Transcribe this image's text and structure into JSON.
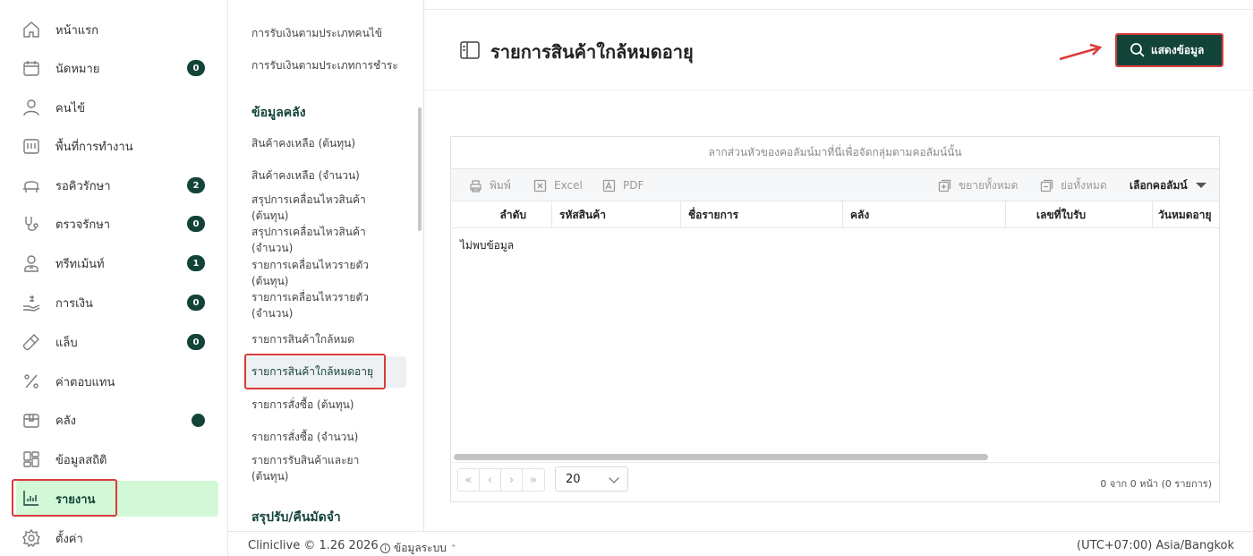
{
  "nav": {
    "items": [
      {
        "label": "หน้าแรก",
        "icon": "home-icon"
      },
      {
        "label": "นัดหมาย",
        "icon": "calendar-icon",
        "badge": "0"
      },
      {
        "label": "คนไข้",
        "icon": "person-icon"
      },
      {
        "label": "พื้นที่การทำงาน",
        "icon": "workspace-icon"
      },
      {
        "label": "รอคิวรักษา",
        "icon": "queue-icon",
        "badge": "2"
      },
      {
        "label": "ตรวจรักษา",
        "icon": "stethoscope-icon",
        "badge": "0"
      },
      {
        "label": "ทรีทเม้นท์",
        "icon": "treatment-icon",
        "badge": "1"
      },
      {
        "label": "การเงิน",
        "icon": "finance-icon",
        "badge": "0"
      },
      {
        "label": "แล็บ",
        "icon": "lab-tube-icon",
        "badge": "0"
      },
      {
        "label": "ค่าตอบแทน",
        "icon": "percent-icon"
      },
      {
        "label": "คลัง",
        "icon": "inventory-box-icon"
      },
      {
        "label": "ข้อมูลสถิติ",
        "icon": "statistics-icon"
      },
      {
        "label": "รายงาน",
        "icon": "report-chart-icon"
      },
      {
        "label": "ตั้งค่า",
        "icon": "gear-icon"
      }
    ]
  },
  "submenu": {
    "top_items": [
      "การรับเงินตามประเภทคนไข้",
      "การรับเงินตามประเภทการชำระ"
    ],
    "section_inventory": "ข้อมูลคลัง",
    "items": [
      "สินค้าคงเหลือ (ต้นทุน)",
      "สินค้าคงเหลือ (จำนวน)",
      "สรุปการเคลื่อนไหวสินค้า (ต้นทุน)",
      "สรุปการเคลื่อนไหวสินค้า (จำนวน)",
      "รายการเคลื่อนไหวรายตัว (ต้นทุน)",
      "รายการเคลื่อนไหวรายตัว (จำนวน)",
      "รายการสินค้าใกล้หมด",
      "รายการสินค้าใกล้หมดอายุ",
      "รายการสั่งซื้อ (ต้นทุน)",
      "รายการสั่งซื้อ (จำนวน)",
      "รายการรับสินค้าและยา (ต้นทุน)"
    ],
    "section_summary": "สรุปรับ/คืนมัดจำ"
  },
  "page": {
    "title": "รายการสินค้าใกล้หมดอายุ",
    "show_button": "แสดงข้อมูล"
  },
  "grid": {
    "group_hint": "ลากส่วนหัวของคอลัมน์มาที่นี่เพื่อจัดกลุ่มตามคอลัมน์นั้น",
    "toolbar": {
      "print": "พิมพ์",
      "excel": "Excel",
      "pdf": "PDF",
      "expand_all": "ขยายทั้งหมด",
      "collapse_all": "ย่อทั้งหมด",
      "choose_columns": "เลือกคอลัมน์"
    },
    "columns": [
      "ลำดับ",
      "รหัสสินค้า",
      "ชื่อรายการ",
      "คลัง",
      "เลขที่ใบรับ",
      "วันหมดอายุ"
    ],
    "empty_message": "ไม่พบข้อมูล",
    "pager": {
      "first": "«",
      "prev": "‹",
      "next": "›",
      "last": "»"
    },
    "page_size": "20",
    "page_info": "0 จาก 0 หน้า (0 รายการ)"
  },
  "footer": {
    "copyright": "Cliniclive © 1.26 2026",
    "system_info": "ข้อมูลระบบ",
    "timezone": "(UTC+07:00) Asia/Bangkok"
  },
  "colors": {
    "primary": "#13443a",
    "active_bg": "#d3f8d7",
    "highlight": "#d93b3b"
  }
}
